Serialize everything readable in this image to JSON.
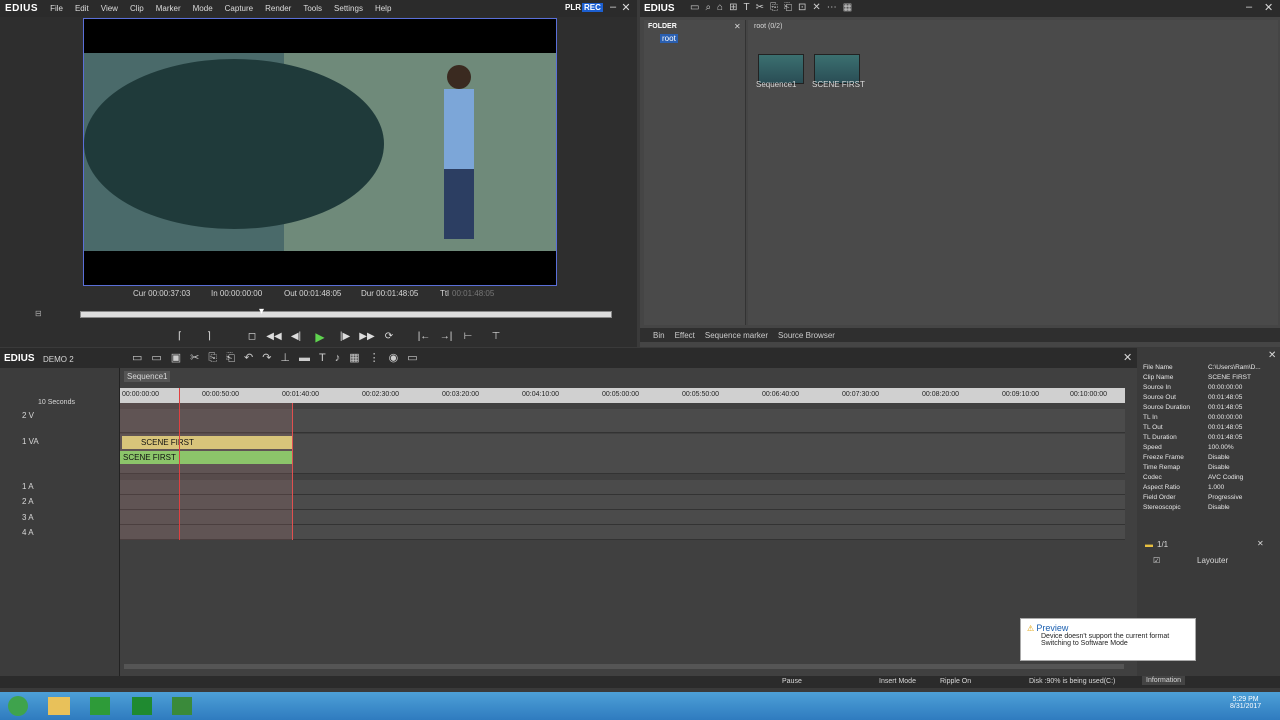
{
  "app": {
    "logo": "EDIUS",
    "plr": "PLR",
    "rec": "REC"
  },
  "menu": [
    "File",
    "Edit",
    "View",
    "Clip",
    "Marker",
    "Mode",
    "Capture",
    "Render",
    "Tools",
    "Settings",
    "Help"
  ],
  "player": {
    "cur": "Cur 00:00:37:03",
    "in": "In 00:00:00:00",
    "out": "Out 00:01:48:05",
    "dur": "Dur 00:01:48:05",
    "ttl_label": "Ttl",
    "ttl": "00:01:48:05"
  },
  "bin": {
    "title": "EDIUS",
    "folder_label": "FOLDER",
    "root_label": "root",
    "root_count": "root (0/2)",
    "items": [
      {
        "name": "Sequence1"
      },
      {
        "name": "SCENE FIRST"
      }
    ],
    "tabs": [
      "Bin",
      "Effect",
      "Sequence marker",
      "Source Browser"
    ]
  },
  "timeline": {
    "title": "EDIUS",
    "project": "DEMO 2",
    "sequence_tab": "Sequence1",
    "scale": "10 Seconds",
    "ruler": [
      "00:00:00:00",
      "00:00:50:00",
      "00:01:40:00",
      "00:02:30:00",
      "00:03:20:00",
      "00:04:10:00",
      "00:05:00:00",
      "00:05:50:00",
      "00:06:40:00",
      "00:07:30:00",
      "00:08:20:00",
      "00:09:10:00",
      "00:10:00:00"
    ],
    "tracks": {
      "v2": "2 V",
      "va1": "1 VA",
      "a1": "1 A",
      "a2": "2 A",
      "a3": "3 A",
      "a4": "4 A"
    },
    "clip_video": "SCENE FIRST",
    "clip_audio": "SCENE FIRST"
  },
  "info": {
    "rows": [
      {
        "k": "File Name",
        "v": "C:\\Users\\Ram\\D..."
      },
      {
        "k": "Clip Name",
        "v": "SCENE FIRST"
      },
      {
        "k": "Source In",
        "v": "00:00:00:00"
      },
      {
        "k": "Source Out",
        "v": "00:01:48:05"
      },
      {
        "k": "Source Duration",
        "v": "00:01:48:05"
      },
      {
        "k": "TL In",
        "v": "00:00:00:00"
      },
      {
        "k": "TL Out",
        "v": "00:01:48:05"
      },
      {
        "k": "TL Duration",
        "v": "00:01:48:05"
      },
      {
        "k": "Speed",
        "v": "100.00%"
      },
      {
        "k": "Freeze Frame",
        "v": "Disable"
      },
      {
        "k": "Time Remap",
        "v": "Disable"
      },
      {
        "k": "Codec",
        "v": "AVC Coding"
      },
      {
        "k": "Aspect Ratio",
        "v": "1.000"
      },
      {
        "k": "Field Order",
        "v": "Progressive"
      },
      {
        "k": "Stereoscopic",
        "v": "Disable"
      }
    ]
  },
  "layouter": {
    "page": "1/1",
    "item": "Layouter"
  },
  "status": {
    "pause": "Pause",
    "insert": "Insert Mode",
    "ripple": "Ripple On",
    "disk": "Disk :90% is being used(C:)",
    "info": "Information"
  },
  "toast": {
    "title": "Preview",
    "line1": "Device doesn't support the current format",
    "line2": "Switching to Software Mode"
  },
  "clock": {
    "time": "5:29 PM",
    "date": "8/31/2017"
  }
}
